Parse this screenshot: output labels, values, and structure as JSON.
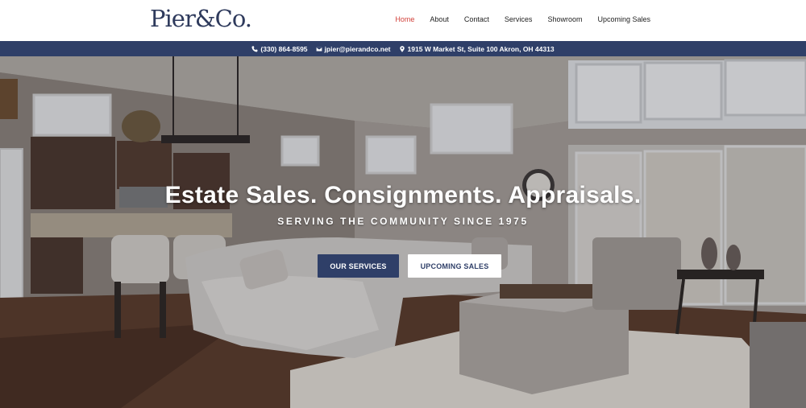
{
  "brand": {
    "logo_text": "Pier&Co."
  },
  "nav": {
    "items": [
      {
        "label": "Home",
        "active": true
      },
      {
        "label": "About",
        "active": false
      },
      {
        "label": "Contact",
        "active": false
      },
      {
        "label": "Services",
        "active": false
      },
      {
        "label": "Showroom",
        "active": false
      },
      {
        "label": "Upcoming Sales",
        "active": false
      }
    ]
  },
  "infobar": {
    "phone": "(330) 864-8595",
    "email": "jpier@pierandco.net",
    "address": "1915 W Market St, Suite 100 Akron, OH 44313"
  },
  "hero": {
    "title": "Estate Sales. Consignments. Appraisals.",
    "subtitle": "SERVING THE COMMUNITY SINCE 1975",
    "primary_button": "OUR SERVICES",
    "secondary_button": "UPCOMING SALES"
  },
  "colors": {
    "navy": "#2f3f68",
    "nav_active": "#d2413a",
    "logo": "#2e3a5c"
  }
}
